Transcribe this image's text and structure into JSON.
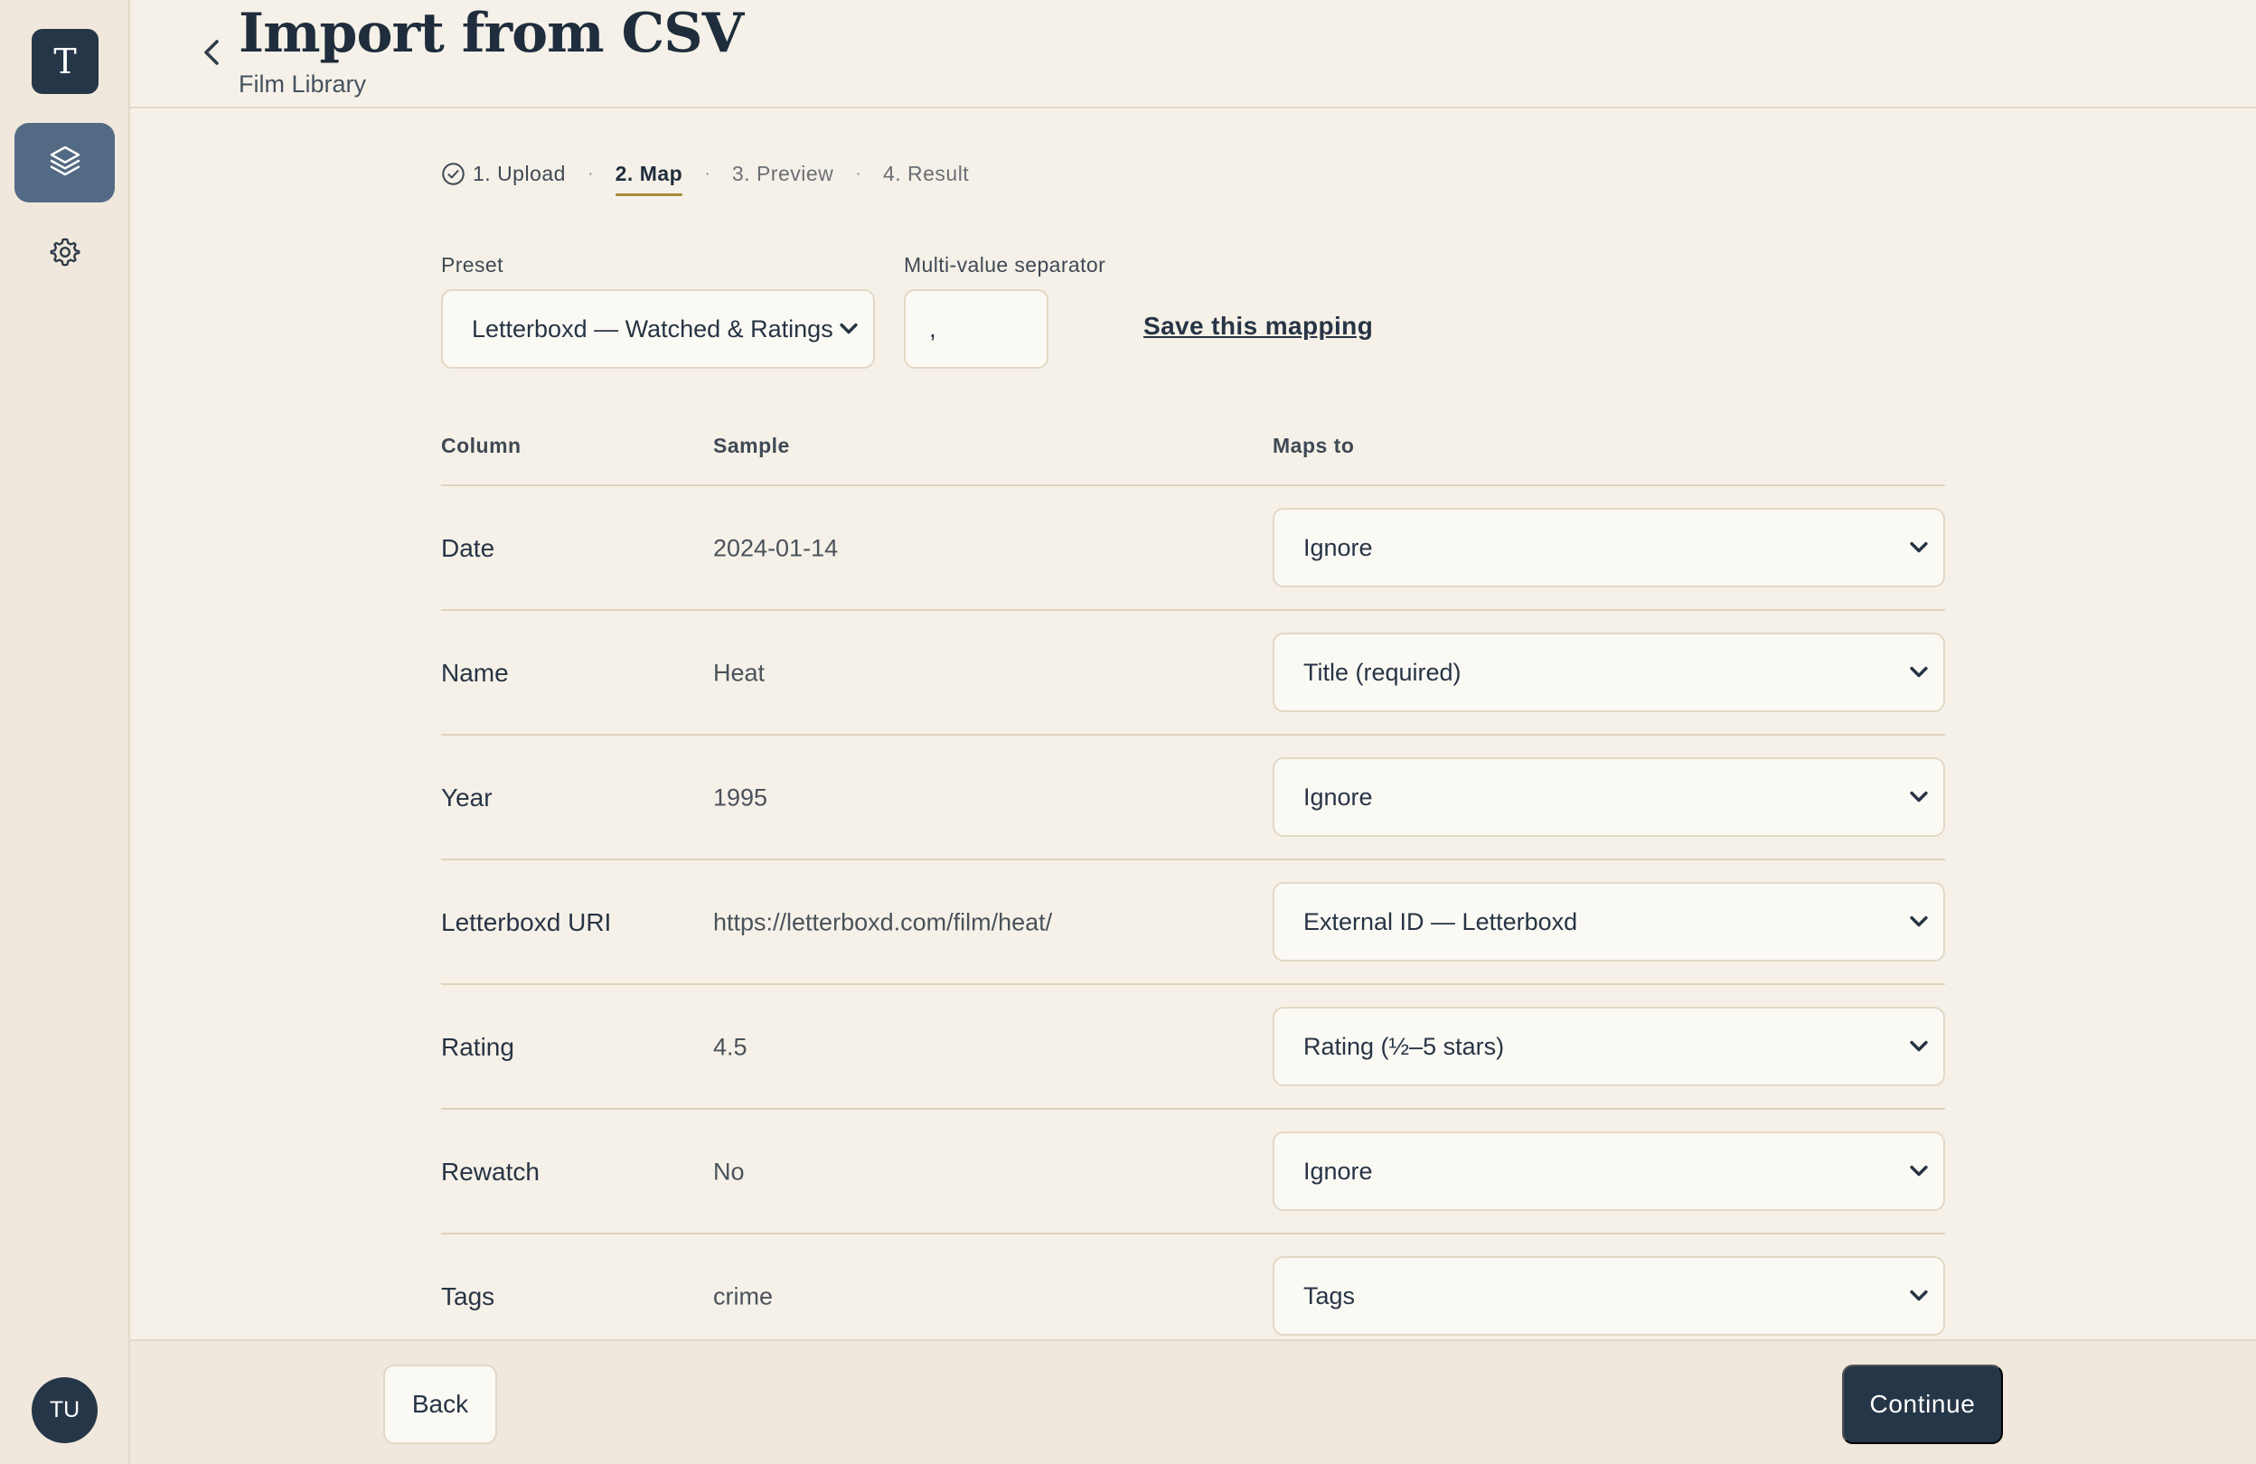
{
  "app": {
    "logo_letter": "T",
    "avatar_initials": "TU"
  },
  "header": {
    "title": "Import from CSV",
    "subtitle": "Film Library"
  },
  "stepper": {
    "steps": [
      {
        "label": "1. Upload",
        "state": "done"
      },
      {
        "label": "2. Map",
        "state": "active"
      },
      {
        "label": "3. Preview",
        "state": "pending"
      },
      {
        "label": "4. Result",
        "state": "pending"
      }
    ],
    "separator": "·"
  },
  "mapping_options": {
    "preset_label": "Preset",
    "preset_value": "Letterboxd — Watched & Ratings",
    "separator_label": "Multi-value separator",
    "separator_value": ",",
    "save_link": "Save this mapping"
  },
  "table": {
    "headers": {
      "column": "Column",
      "sample": "Sample",
      "maps_to": "Maps to"
    },
    "rows": [
      {
        "column": "Date",
        "sample": "2024-01-14",
        "maps_to": "Ignore"
      },
      {
        "column": "Name",
        "sample": "Heat",
        "maps_to": "Title (required)"
      },
      {
        "column": "Year",
        "sample": "1995",
        "maps_to": "Ignore"
      },
      {
        "column": "Letterboxd URI",
        "sample": "https://letterboxd.com/film/heat/",
        "maps_to": "External ID — Letterboxd"
      },
      {
        "column": "Rating",
        "sample": "4.5",
        "maps_to": "Rating (½–5 stars)"
      },
      {
        "column": "Rewatch",
        "sample": "No",
        "maps_to": "Ignore"
      },
      {
        "column": "Tags",
        "sample": "crime",
        "maps_to": "Tags"
      }
    ]
  },
  "footer": {
    "back_label": "Back",
    "continue_label": "Continue"
  },
  "colors": {
    "background": "#f6f1e8",
    "sidebar": "#f0e8dc",
    "primary": "#253648",
    "nav_active": "#536a84",
    "accent_underline": "#a8893c",
    "border": "#e3d8c6"
  }
}
